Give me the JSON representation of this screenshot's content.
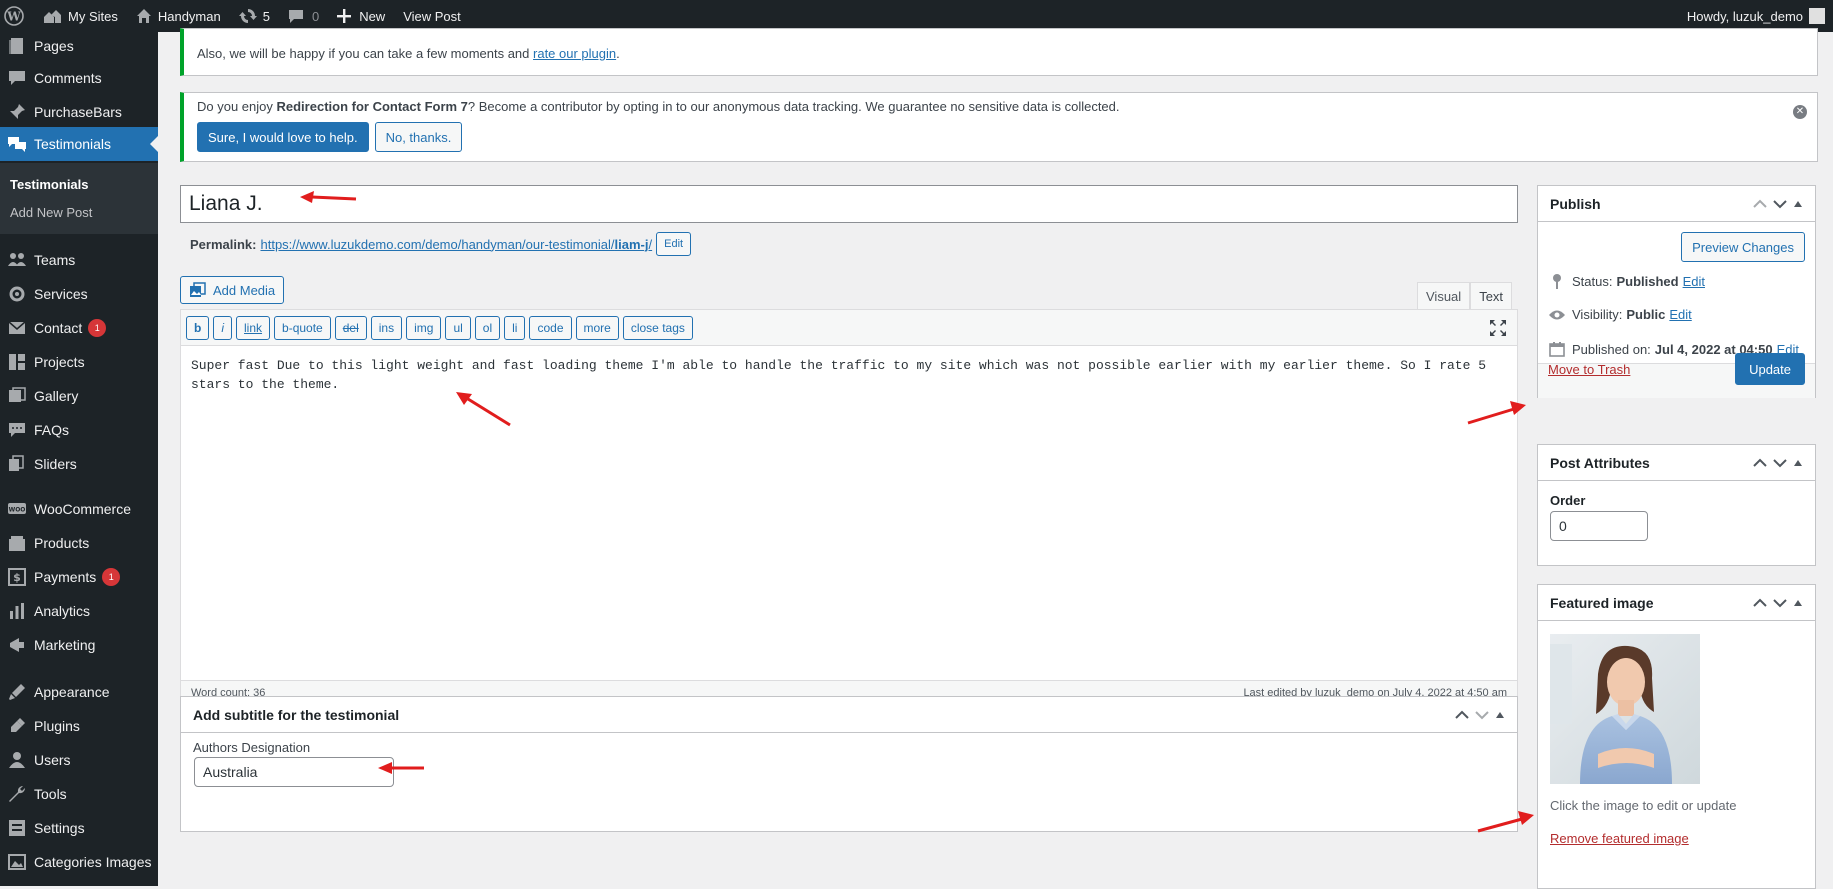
{
  "adminbar": {
    "my_sites": "My Sites",
    "site_name": "Handyman",
    "updates_count": "5",
    "comments_count": "0",
    "new_label": "New",
    "view_post": "View Post",
    "howdy": "Howdy, luzuk_demo"
  },
  "sidebar": {
    "items": [
      {
        "label": "Pages",
        "icon": "pages-icon"
      },
      {
        "label": "Comments",
        "icon": "comments-icon"
      },
      {
        "label": "PurchaseBars",
        "icon": "pin-icon"
      },
      {
        "label": "Testimonials",
        "icon": "testimonials-icon"
      },
      {
        "label": "Teams",
        "icon": "teams-icon"
      },
      {
        "label": "Services",
        "icon": "services-icon"
      },
      {
        "label": "Contact",
        "icon": "mail-icon",
        "badge": "1"
      },
      {
        "label": "Projects",
        "icon": "projects-icon"
      },
      {
        "label": "Gallery",
        "icon": "gallery-icon"
      },
      {
        "label": "FAQs",
        "icon": "faq-icon"
      },
      {
        "label": "Sliders",
        "icon": "sliders-icon"
      },
      {
        "label": "WooCommerce",
        "icon": "woocommerce-icon"
      },
      {
        "label": "Products",
        "icon": "products-icon"
      },
      {
        "label": "Payments",
        "icon": "payments-icon",
        "badge": "1"
      },
      {
        "label": "Analytics",
        "icon": "analytics-icon"
      },
      {
        "label": "Marketing",
        "icon": "marketing-icon"
      },
      {
        "label": "Appearance",
        "icon": "appearance-icon"
      },
      {
        "label": "Plugins",
        "icon": "plugins-icon"
      },
      {
        "label": "Users",
        "icon": "users-icon"
      },
      {
        "label": "Tools",
        "icon": "tools-icon"
      },
      {
        "label": "Settings",
        "icon": "settings-icon"
      },
      {
        "label": "Categories Images",
        "icon": "categories-images-icon"
      }
    ],
    "submenu": [
      "Testimonials",
      "Add New Post"
    ]
  },
  "notices": {
    "review_text": "Also, we will be happy if you can take a few moments and ",
    "review_link": "rate our plugin",
    "review_end": ".",
    "tracking_prefix": "Do you enjoy ",
    "tracking_bold": "Redirection for Contact Form 7",
    "tracking_suffix": "? Become a contributor by opting in to our anonymous data tracking. We guarantee no sensitive data is collected.",
    "accept_label": "Sure, I would love to help.",
    "decline_label": "No, thanks."
  },
  "post": {
    "title": "Liana J.",
    "permalink_label": "Permalink:",
    "permalink_base": "https://www.luzukdemo.com/demo/handyman/our-testimonial/",
    "permalink_slug": "liam-j",
    "permalink_end": "/",
    "permalink_edit": "Edit"
  },
  "editor": {
    "add_media": "Add Media",
    "tab_visual": "Visual",
    "tab_text": "Text",
    "quicktags": [
      "b",
      "i",
      "link",
      "b-quote",
      "del",
      "ins",
      "img",
      "ul",
      "ol",
      "li",
      "code",
      "more",
      "close tags"
    ],
    "content": "Super fast Due to this light weight and fast loading theme I'm able to handle the traffic to my site which was not possible earlier with my earlier theme. So I rate 5 stars to the theme.",
    "word_count": "Word count: 36",
    "last_edited": "Last edited by luzuk_demo on July 4, 2022 at 4:50 am"
  },
  "subtitle_box": {
    "title": "Add subtitle for the testimonial",
    "field_label": "Authors Designation",
    "field_value": "Australia"
  },
  "publish": {
    "title": "Publish",
    "preview_label": "Preview Changes",
    "status_label": "Status:",
    "status_value": "Published",
    "visibility_label": "Visibility:",
    "visibility_value": "Public",
    "published_label": "Published on:",
    "published_value": "Jul 4, 2022 at 04:50",
    "edit_label": "Edit",
    "trash_label": "Move to Trash",
    "update_label": "Update"
  },
  "attributes": {
    "title": "Post Attributes",
    "order_label": "Order",
    "order_value": "0"
  },
  "featured": {
    "title": "Featured image",
    "hint": "Click the image to edit or update",
    "remove_label": "Remove featured image"
  },
  "colors": {
    "admin_dark": "#1d2327",
    "accent": "#2271b1",
    "annotation_arrow": "#e11d1d",
    "notice_border": "#00a32a"
  }
}
